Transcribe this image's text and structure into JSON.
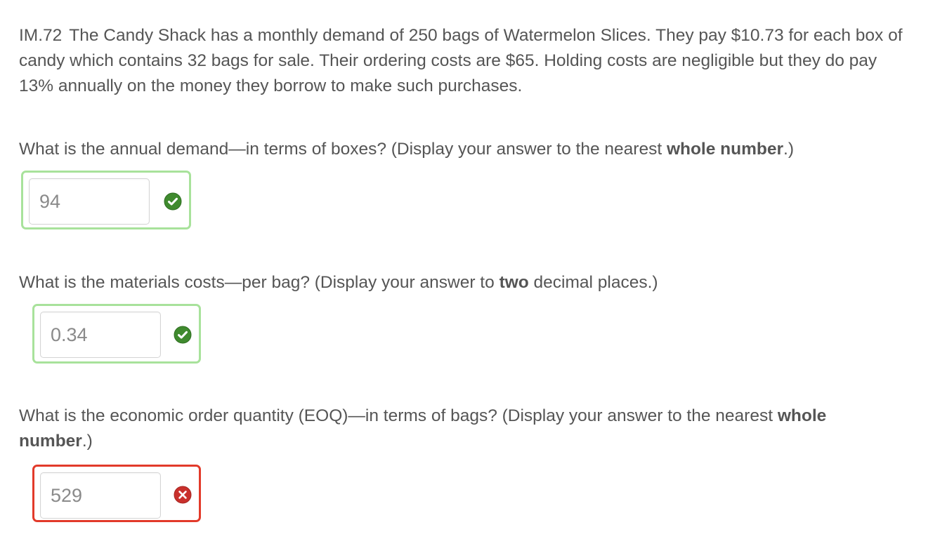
{
  "problem": {
    "id": "IM.72",
    "text": "The Candy Shack has a monthly demand of 250 bags of Watermelon Slices. They pay $10.73 for each box of candy which contains 32 bags for sale. Their ordering costs are $65. Holding costs are negligible but they do pay 13% annually on the money they borrow to make such purchases."
  },
  "questions": [
    {
      "prompt_before": "What is the annual demand—in terms of boxes? (Display your answer to the nearest ",
      "prompt_bold": "whole number",
      "prompt_after": ".)",
      "answer": "94",
      "status": "correct",
      "status_icon": "check-circle-icon"
    },
    {
      "prompt_before": "What is the materials costs—per bag? (Display your answer to ",
      "prompt_bold": "two",
      "prompt_after": " decimal places.)",
      "answer": "0.34",
      "status": "correct",
      "status_icon": "check-circle-icon"
    },
    {
      "prompt_before": "What is the economic order quantity (EOQ)—in terms of bags? (Display your answer to the nearest ",
      "prompt_bold": "whole number",
      "prompt_after": ".)",
      "answer": "529",
      "status": "incorrect",
      "status_icon": "x-circle-icon"
    }
  ],
  "colors": {
    "text": "#555555",
    "correct_border": "#a8e29b",
    "incorrect_border": "#e23a2a",
    "correct_icon": "#3f8a2e",
    "incorrect_icon": "#c9302c"
  }
}
